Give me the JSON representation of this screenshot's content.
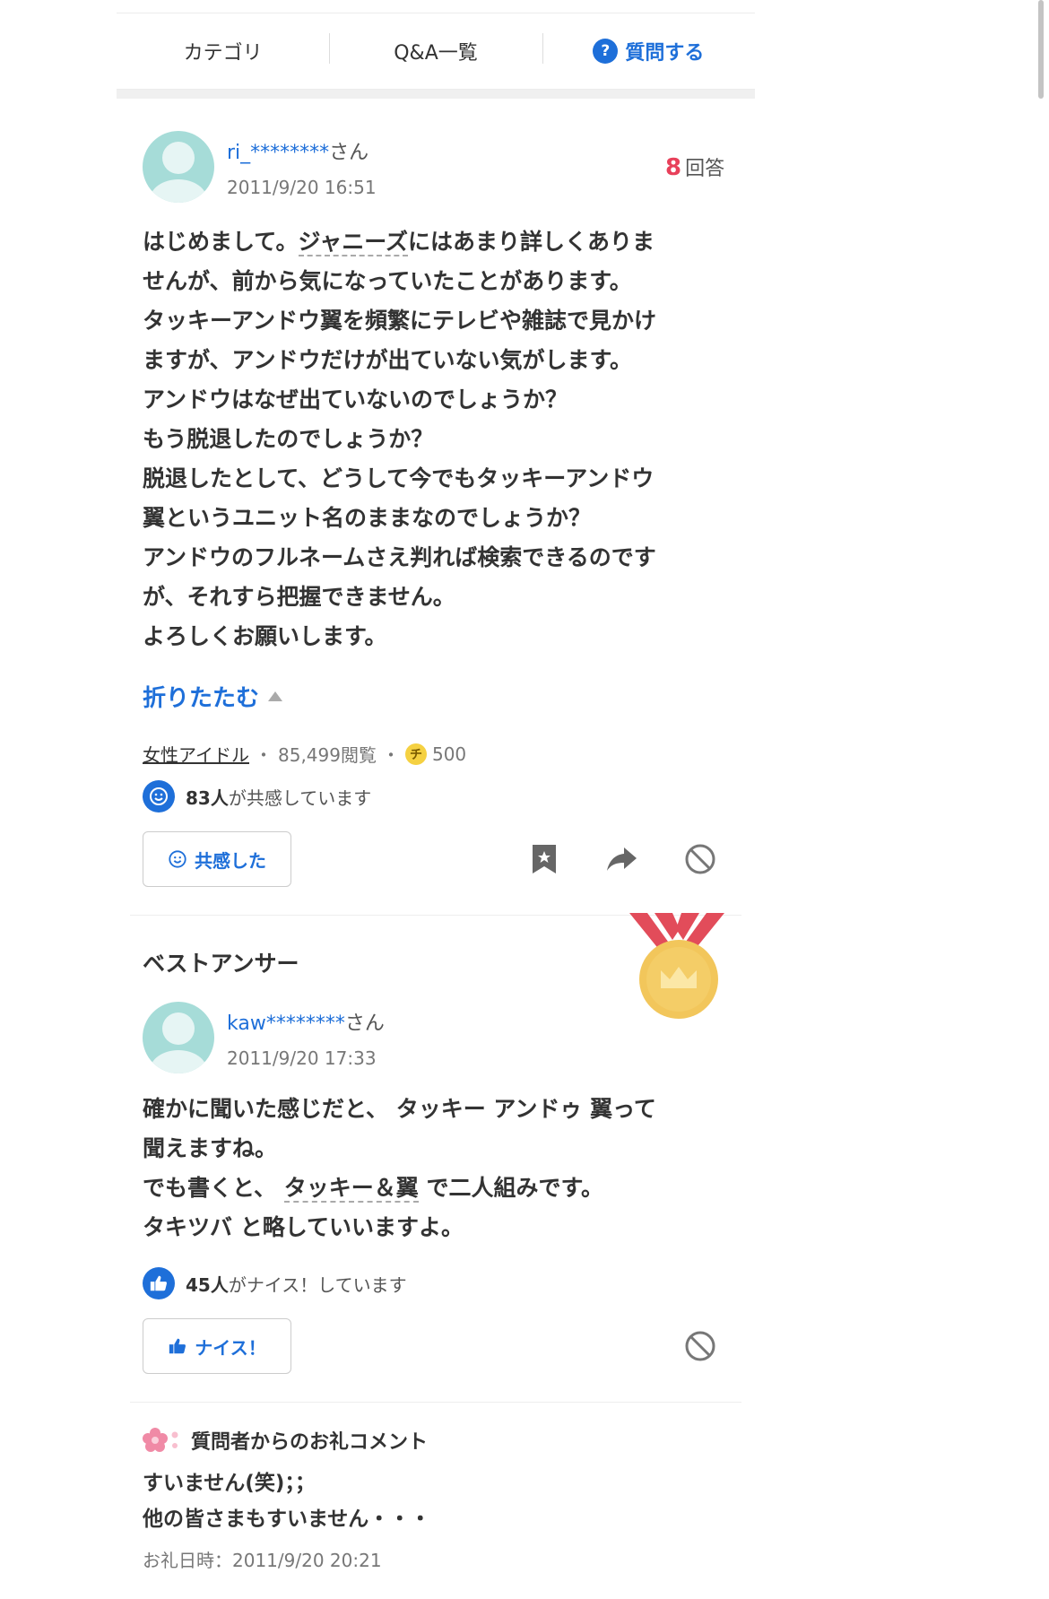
{
  "nav": {
    "category": "カテゴリ",
    "qa_list": "Q&A一覧",
    "ask_icon": "?",
    "ask": "質問する"
  },
  "question": {
    "user": "ri_********",
    "honorific": "さん",
    "date": "2011/9/20 16:51",
    "answer_count": "8",
    "answer_count_label": "回答",
    "lines": [
      [
        "はじめまして。",
        "ジャニーズ",
        "にはあまり詳しくありま"
      ],
      "せんが、前から気になっていたことがあります。",
      "タッキーアンドウ翼を頻繁にテレビや雑誌で見かけ",
      "ますが、アンドウだけが出ていない気がします。",
      "アンドウはなぜ出ていないのでしょうか？",
      "もう脱退したのでしょうか？",
      "脱退したとして、どうして今でもタッキーアンドウ",
      "翼というユニット名のままなのでしょうか？",
      "アンドウのフルネームさえ判れば検索できるのです",
      "が、それすら把握できません。",
      "よろしくお願いします。"
    ],
    "fold_label": "折りたたむ",
    "category": "女性アイドル",
    "views": "85,499閲覧",
    "coin_icon": "チ",
    "coins": "500",
    "empathy_count": "83人",
    "empathy_text": "が共感しています",
    "empathy_button": "共感した"
  },
  "best_answer": {
    "title": "ベストアンサー",
    "user": "kaw********",
    "honorific": "さん",
    "date": "2011/9/20 17:33",
    "lines": [
      "確かに聞いた感じだと、 タッキー アンドゥ 翼って",
      "聞えますね。",
      [
        "でも書くと、 ",
        "タッキー＆翼",
        " で二人組みです。"
      ],
      "タキツバ と略していいますよ。"
    ],
    "nice_count": "45人",
    "nice_text": "がナイス！しています",
    "nice_button": "ナイス！"
  },
  "thanks": {
    "title": "質問者からのお礼コメント",
    "lines": [
      "すいません(笑)；；",
      "他の皆さまもすいません・・・"
    ],
    "date_label": "お礼日時：2011/9/20 20:21"
  },
  "colors": {
    "link_blue": "#1e6fd9",
    "answer_count_red": "#e8405a",
    "avatar_teal": "#a6dcd8",
    "medal_gold": "#f2c65b"
  }
}
